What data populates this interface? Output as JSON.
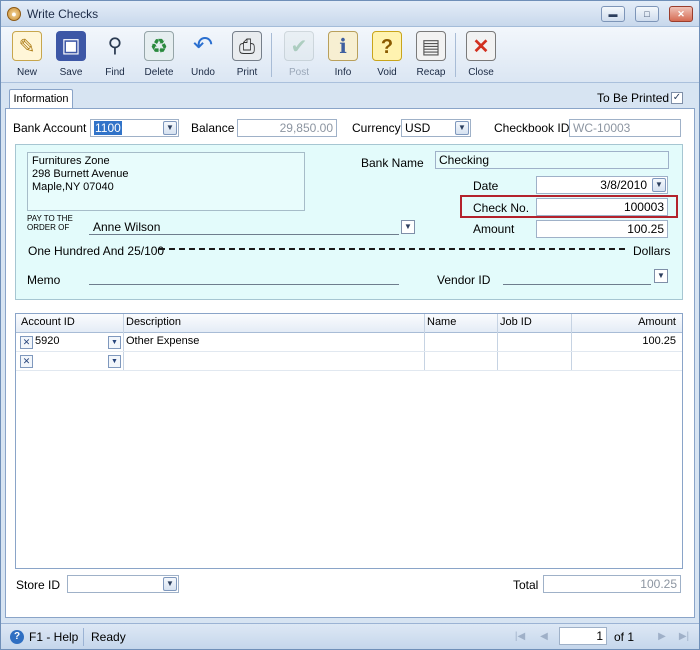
{
  "window": {
    "title": "Write Checks",
    "minimize_icon": "minimize-icon",
    "maximize_icon": "maximize-icon",
    "close_icon": "close-icon"
  },
  "toolbar": {
    "new": "New",
    "save": "Save",
    "find": "Find",
    "delete": "Delete",
    "undo": "Undo",
    "print": "Print",
    "post": "Post",
    "info": "Info",
    "void": "Void",
    "recap": "Recap",
    "close": "Close"
  },
  "tabs": {
    "information": "Information"
  },
  "to_be_printed": {
    "label": "To Be Printed",
    "checked": true
  },
  "header": {
    "bank_account_label": "Bank Account",
    "bank_account_value": "1100",
    "balance_label": "Balance",
    "balance_value": "29,850.00",
    "currency_label": "Currency",
    "currency_value": "USD",
    "checkbook_label": "Checkbook ID",
    "checkbook_value": "WC-10003"
  },
  "check": {
    "address_line1": "Furnitures Zone",
    "address_line2": "298 Burnett Avenue",
    "address_line3": "Maple,NY 07040",
    "bank_name_label": "Bank Name",
    "bank_name_value": "Checking",
    "date_label": "Date",
    "date_value": "3/8/2010",
    "check_no_label": "Check No.",
    "check_no_value": "100003",
    "pay_to_label_1": "PAY TO THE",
    "pay_to_label_2": "ORDER OF",
    "payee": "Anne Wilson",
    "amount_label": "Amount",
    "amount_value": "100.25",
    "amount_words": "One Hundred  And 25/100",
    "dollars_label": "Dollars",
    "memo_label": "Memo",
    "memo_value": "",
    "vendor_label": "Vendor ID",
    "vendor_value": ""
  },
  "grid": {
    "columns": [
      "Account ID",
      "Description",
      "Name",
      "Job ID",
      "Amount"
    ],
    "rows": [
      {
        "account_id": "5920",
        "description": "Other Expense",
        "name": "",
        "job_id": "",
        "amount": "100.25"
      },
      {
        "account_id": "",
        "description": "",
        "name": "",
        "job_id": "",
        "amount": ""
      }
    ]
  },
  "footer": {
    "store_label": "Store ID",
    "store_value": "",
    "total_label": "Total",
    "total_value": "100.25"
  },
  "statusbar": {
    "help": "F1 - Help",
    "status": "Ready",
    "page": "1",
    "of_label": "of 1"
  },
  "colors": {
    "highlight": "#b3222c",
    "check_bg": "#e3fbfb",
    "window_bg": "#d7e4f2"
  }
}
